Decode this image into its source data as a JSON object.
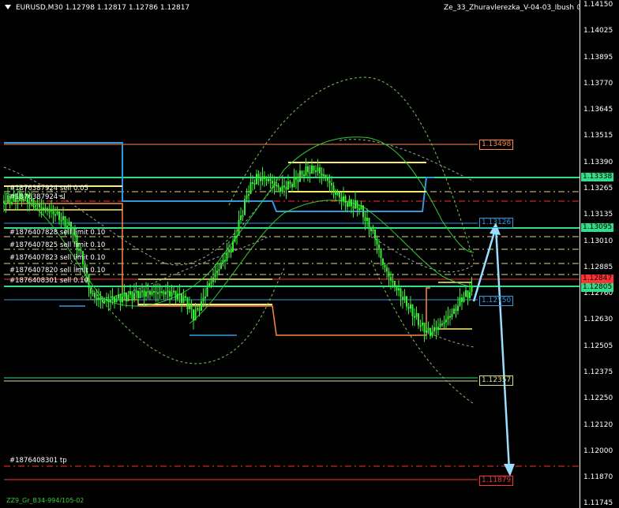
{
  "header": {
    "symbol_info": "EURUSD,M30  1.12798 1.12817 1.12786 1.12817",
    "indicator_name": "Ze_33_Zhuravlerezka_V-04-03_Ibush",
    "smiley": "☺"
  },
  "price_axis": {
    "labels": [
      "1.14150",
      "1.14025",
      "1.13895",
      "1.13770",
      "1.13645",
      "1.13515",
      "1.13390",
      "1.13265",
      "1.13135",
      "1.13010",
      "1.12885",
      "1.12760",
      "1.12630",
      "1.12505",
      "1.12375",
      "1.12250",
      "1.12120",
      "1.12000",
      "1.11870",
      "1.11745"
    ],
    "tags": [
      {
        "text": "1.13338",
        "color": "#33dd88"
      },
      {
        "text": "1.13095",
        "color": "#33dd88"
      },
      {
        "text": "1.12847",
        "color": "#ff3333"
      },
      {
        "text": "1.12805",
        "color": "#33dd88"
      }
    ]
  },
  "orders": [
    "#1876387924 sell 0.05",
    "#1876387924 sl",
    "#1876407828 sell limit 0.10",
    "#1876407825 sell limit 0.10",
    "#1876407823 sell limit 0.10",
    "#1876407820 sell limit 0.10",
    "#1876408301 sell 0.10",
    "#1876408301 tp"
  ],
  "level_boxes": [
    {
      "text": "1.13498",
      "color": "#ff8844"
    },
    {
      "text": "1.13126",
      "color": "#3399dd"
    },
    {
      "text": "1.12750",
      "color": "#3399dd"
    },
    {
      "text": "1.12357",
      "color": "#dddd88"
    },
    {
      "text": "1.11879",
      "color": "#ff3333"
    }
  ],
  "footer": "ZZ9_Gr_B34-994/105-02",
  "colors": {
    "background": "#000000",
    "candle": "#33ee33",
    "blue_line": "#3399dd",
    "orange_line": "#ff8844",
    "yellow_line": "#ffee66",
    "green_line": "#33dd88",
    "red_line": "#ff3333",
    "arrow": "#99ddff"
  }
}
